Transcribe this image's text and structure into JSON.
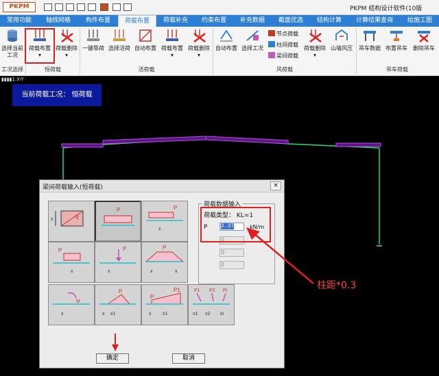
{
  "titlebar": {
    "logo": "PKPM",
    "app_title": "PKPM 结构设计软件(10版"
  },
  "menu_tabs": [
    "常用功能",
    "轴线网格",
    "构件布置",
    "荷载布置",
    "荷载补充",
    "约束布置",
    "补充数据",
    "截面优选",
    "结构计算",
    "计算结果查询",
    "绘施工图"
  ],
  "active_tab": "荷载布置",
  "ribbon": {
    "buttons": [
      {
        "label": "选择当前",
        "label2": "工况"
      },
      {
        "label": "荷载布置",
        "label2": "▾"
      },
      {
        "label": "荷载删除",
        "label2": "▾"
      },
      {
        "label": "一键靠荷",
        "label2": ""
      },
      {
        "label": "选择活荷",
        "label2": ""
      },
      {
        "label": "自动布置",
        "label2": ""
      },
      {
        "label": "荷载布置",
        "label2": "▾"
      },
      {
        "label": "荷载删除",
        "label2": "▾"
      },
      {
        "label": "自动布置",
        "label2": ""
      },
      {
        "label": "选择工况",
        "label2": ""
      },
      {
        "label": "荷载删除",
        "label2": "▾"
      },
      {
        "label": "山墙风压",
        "label2": ""
      },
      {
        "label": "吊车数据",
        "label2": ""
      },
      {
        "label": "布置吊车",
        "label2": ""
      },
      {
        "label": "删除吊车",
        "label2": ""
      }
    ],
    "small_items": [
      "节点荷载",
      "柱间荷载",
      "梁间荷载"
    ],
    "groups": [
      "工况选择",
      "恒荷载",
      "活荷载",
      "风荷载",
      "吊车荷载"
    ]
  },
  "canvas": {
    "view_label": "▮▮▮▮1:X-Y",
    "current_loadcase": "当前荷载工况：  恒荷载"
  },
  "dialog": {
    "title": "梁间荷载输入(恒荷载)",
    "close": "×",
    "params_title": "荷载数据输入",
    "load_type": "荷载类型：  KL=1",
    "p_label": "P",
    "p_value": "2.37",
    "unit": "kN/m",
    "disabled_values": [
      "0",
      "0",
      "0"
    ],
    "ok": "确定",
    "cancel": "取消"
  },
  "annotation": "柱距*0.3",
  "colors": {
    "accent": "#2c7fd4",
    "highlight": "#e02020",
    "loadcase_bg": "#0b1a9c",
    "column": "#20e070",
    "load": "#c040ff"
  }
}
